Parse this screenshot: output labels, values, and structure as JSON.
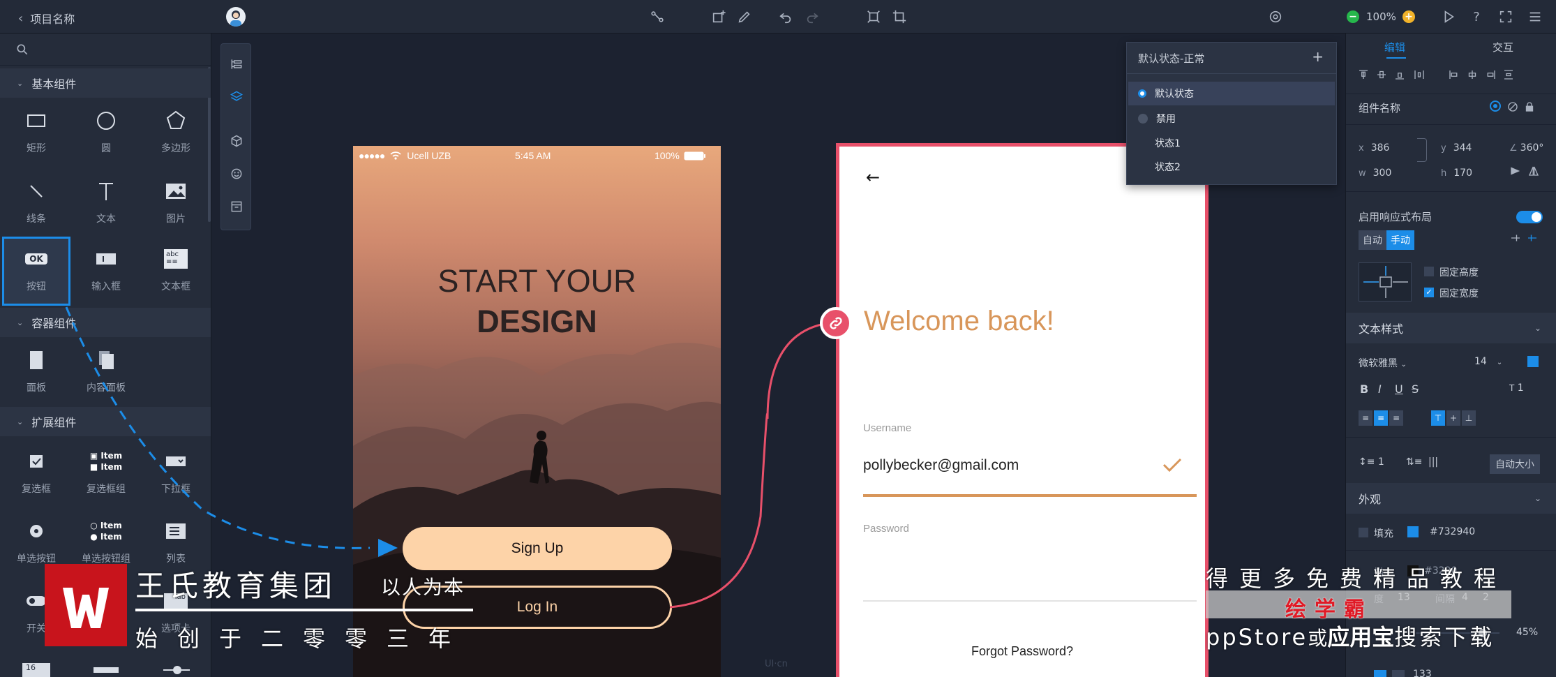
{
  "topbar": {
    "back_label": "项目名称",
    "zoom": "100%"
  },
  "search": {
    "placeholder": ""
  },
  "left": {
    "basic_title": "基本组件",
    "basic": [
      "矩形",
      "圆",
      "多边形",
      "线条",
      "文本",
      "图片",
      "按钮",
      "输入框",
      "文本框"
    ],
    "button_glyph": "OK",
    "textbox_glyph": "abc",
    "container_title": "容器组件",
    "container": [
      "面板",
      "内容面板"
    ],
    "ext_title": "扩展组件",
    "ext": [
      "复选框",
      "复选框组",
      "下拉框",
      "单选按钮",
      "单选按钮组",
      "列表",
      "开关",
      "选项卡"
    ],
    "item_text": "Item",
    "tab_glyph": "Tab",
    "stepper_glyph": "16"
  },
  "phone": {
    "carrier": "Ucell UZB",
    "time": "5:45 AM",
    "battery": "100%",
    "headline_1": "START YOUR",
    "headline_2": "DESIGN",
    "signup": "Sign Up",
    "login": "Log In"
  },
  "card": {
    "back_arrow": "←",
    "welcome": "Welcome back!",
    "username_label": "Username",
    "username_value": "pollybecker@gmail.com",
    "password_label": "Password",
    "forgot": "Forgot Password?"
  },
  "canvas_mark": "UI·cn",
  "states": {
    "title": "默认状态-正常",
    "items": [
      "默认状态",
      "禁用",
      "状态1",
      "状态2"
    ]
  },
  "right": {
    "tab_edit": "编辑",
    "tab_interact": "交互",
    "comp_name_label": "组件名称",
    "x_label": "x",
    "x": "386",
    "y_label": "y",
    "y": "344",
    "angle": "360°",
    "w_label": "w",
    "w": "300",
    "h_label": "h",
    "h": "170",
    "responsive_label": "启用响应式布局",
    "auto": "自动",
    "manual": "手动",
    "fixed_height": "固定高度",
    "fixed_width": "固定宽度",
    "text_style_title": "文本样式",
    "font_name": "微软雅黑",
    "font_size": "14",
    "letter_spacing": "1",
    "line_height": "1",
    "auto_size": "自动大小",
    "appearance_title": "外观",
    "fill_label": "填充",
    "fill_hex": "#732940",
    "border_hex": "#3290",
    "border_partial": "描",
    "thickness_partial": "度",
    "thickness_val": "13",
    "gap_label": "间隔",
    "gap_val": "4",
    "gap_val2": "2",
    "opacity": "45%",
    "row_bottom": "133"
  },
  "colors": {
    "accent": "#1c8de8",
    "link": "#e8506a",
    "welcome": "#d8965a",
    "signup_bg": "#fdd3a8",
    "fill_swatch": "#1c8de8"
  },
  "watermark": {
    "org": "王氏教育集团",
    "motto": "以人为本",
    "founded": "始创于二零零三年",
    "promo_1": "得更多免费精品教程",
    "promo_brand": "绘学霸",
    "promo_2_a": "ppStore",
    "promo_2_b": "或",
    "promo_2_c": "应用宝",
    "promo_2_d": "搜索下载"
  }
}
